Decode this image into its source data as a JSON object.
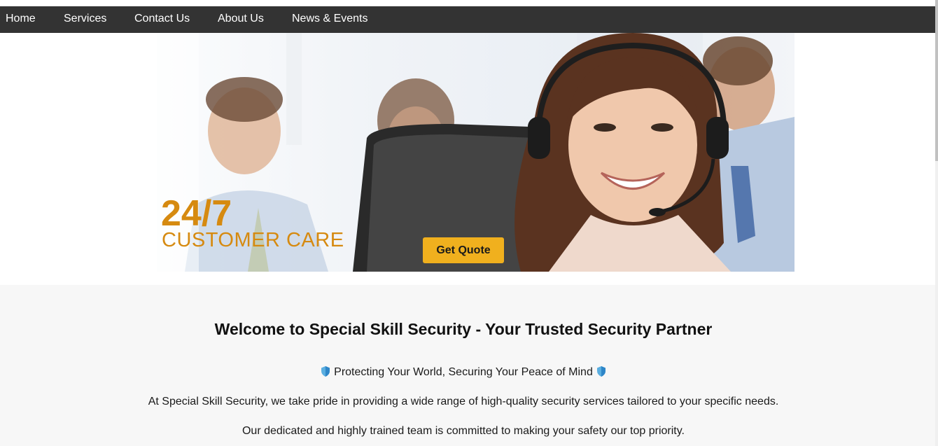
{
  "nav": {
    "items": [
      {
        "label": "Home"
      },
      {
        "label": "Services"
      },
      {
        "label": "Contact Us"
      },
      {
        "label": "About Us"
      },
      {
        "label": "News & Events"
      }
    ]
  },
  "hero": {
    "headline": "24/7",
    "subline": "CUSTOMER CARE",
    "quote_button_label": "Get Quote",
    "image_icon": "customer-service-agent-photo"
  },
  "content": {
    "title": "Welcome to Special Skill Security - Your Trusted Security Partner",
    "tagline": "Protecting Your World, Securing Your Peace of Mind",
    "tagline_icon": "shield-icon",
    "paragraph_1": "At Special Skill Security, we take pride in providing a wide range of high-quality security services tailored to your specific needs.",
    "paragraph_2": "Our dedicated and highly trained team is committed to making your safety our top priority."
  },
  "colors": {
    "nav_background": "#333333",
    "accent_orange": "#d68a10",
    "button_yellow": "#f0b01e",
    "content_background": "#f7f7f7"
  }
}
